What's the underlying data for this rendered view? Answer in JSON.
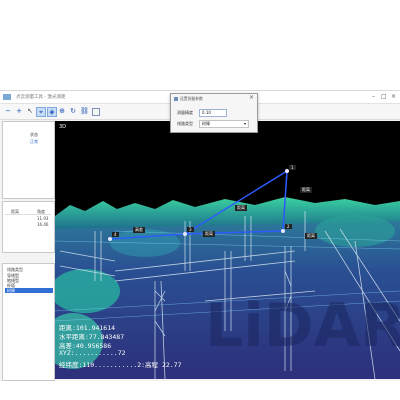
{
  "window": {
    "title": "点云测量工具 - 激光测距"
  },
  "toolbar": {
    "buttons": [
      "minus",
      "plus",
      "pointer",
      "measure",
      "select",
      "zoom",
      "link",
      "grid"
    ]
  },
  "left_panel": {
    "top": {
      "header": "状态",
      "value": "正常"
    },
    "middle": {
      "col_a": "距离",
      "col_b": "角度",
      "row1_b": "11.93",
      "row2_b": "16.46"
    },
    "bottom": {
      "header": "线路类型",
      "items": [
        "导线型",
        "地线型",
        "杆塔",
        "树障"
      ],
      "selected_index": 3
    }
  },
  "viewport": {
    "view_label": "3D",
    "labels": {
      "p1": "1",
      "p2": "2",
      "p3": "3",
      "p4": "4",
      "seg_a": "距离",
      "seg_b": "距离",
      "seg_c": "距离",
      "seg_d": "高差",
      "seg_e": "距离"
    },
    "hud": {
      "line1": "距离:101.941614",
      "line2": "水平距离:77.843487",
      "line3": "高差:40.956586",
      "line4": "XYZ:...........72",
      "line5": "经纬度:110...........2:高程 22.77"
    },
    "watermark": "LiDAR"
  },
  "dialog": {
    "title": "设置测量参数",
    "field1_label": "测量精度",
    "field1_value": "0.10",
    "field2_label": "线路类型",
    "field2_value": "树障"
  }
}
